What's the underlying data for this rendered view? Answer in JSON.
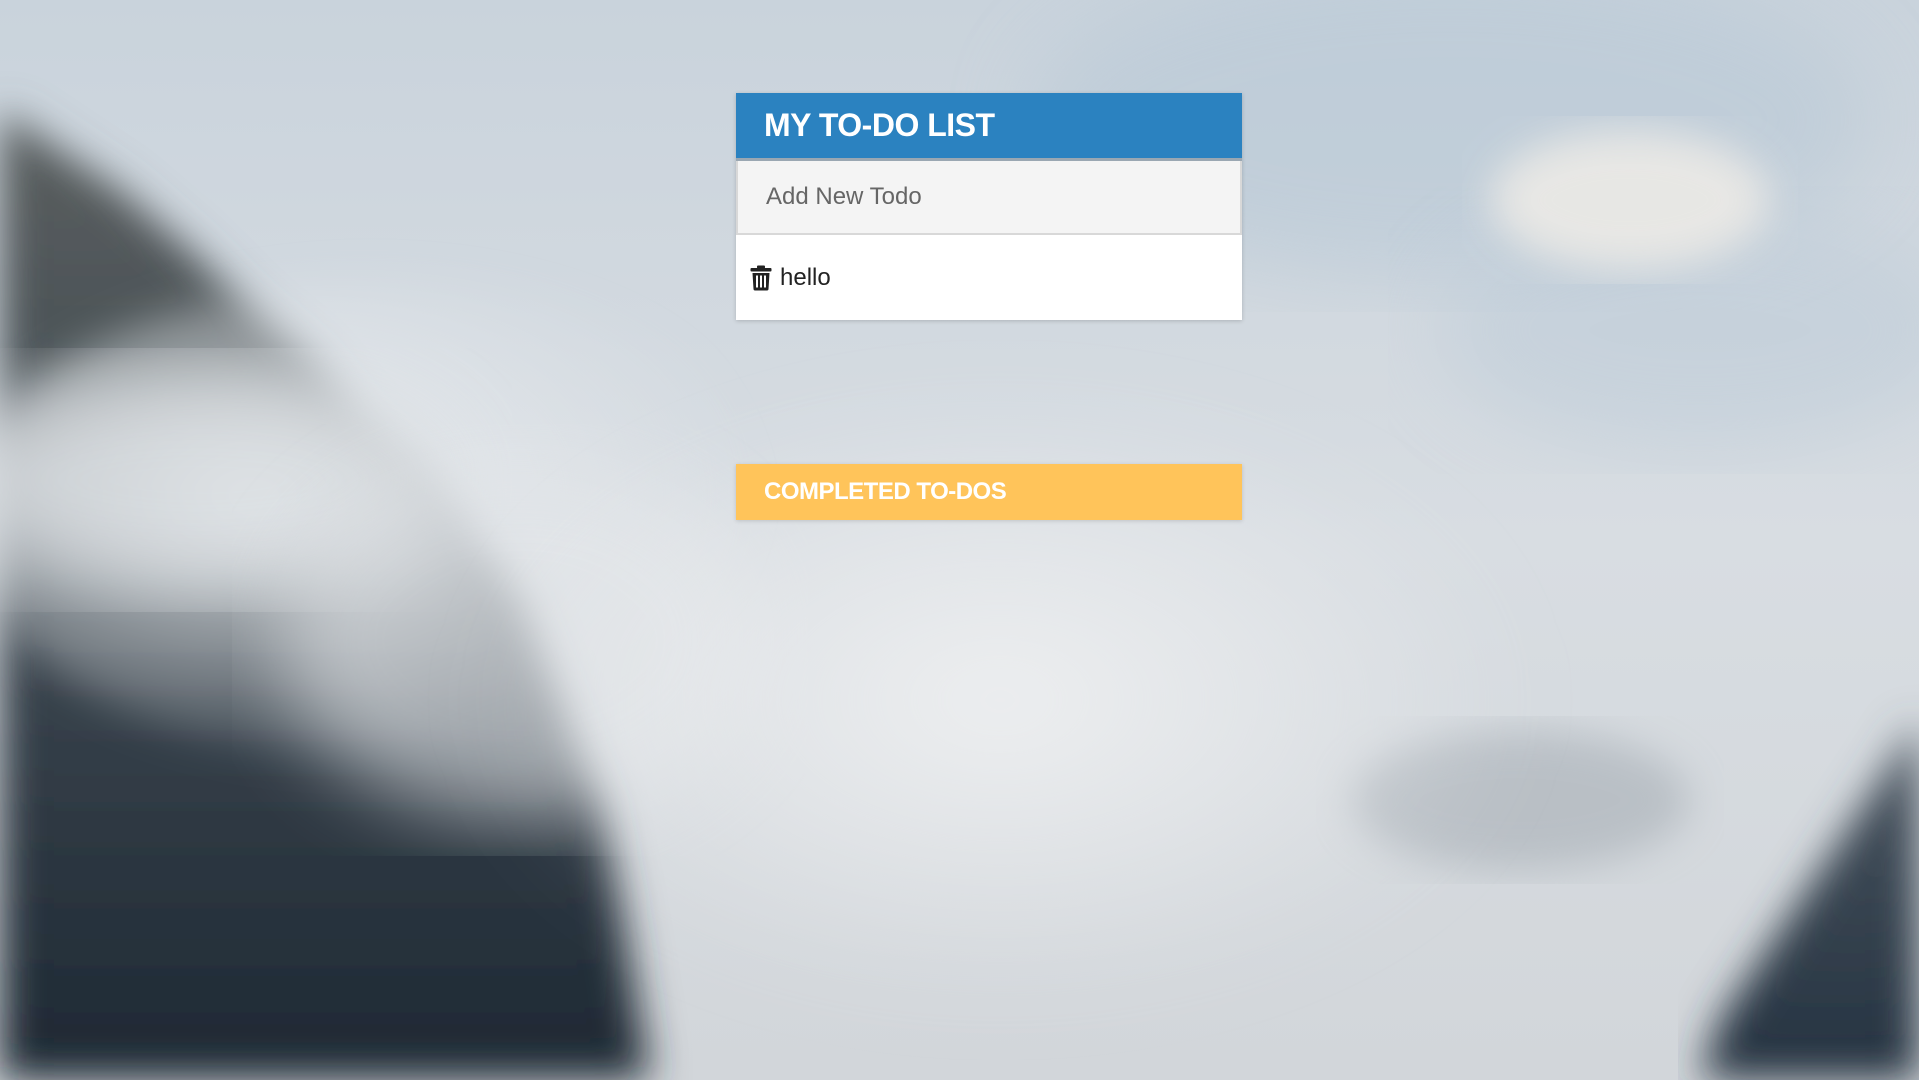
{
  "colors": {
    "todo_header_bg": "#2b82c0",
    "completed_header_bg": "#ffc45a",
    "text_on_header": "#ffffff"
  },
  "todo_panel": {
    "title": "MY TO-DO LIST",
    "input_placeholder": "Add New Todo",
    "input_value": "",
    "items": [
      {
        "text": "hello",
        "delete_icon": "trash-icon"
      }
    ]
  },
  "completed_panel": {
    "title": "COMPLETED TO-DOS",
    "items": []
  }
}
